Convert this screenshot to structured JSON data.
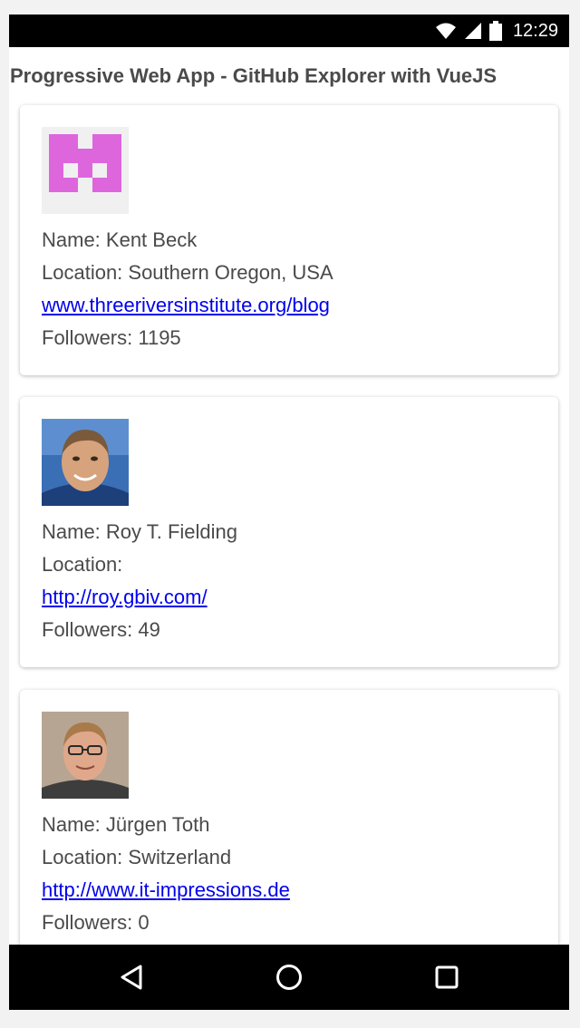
{
  "status_bar": {
    "time": "12:29",
    "icons": [
      "wifi-icon",
      "cell-signal-icon",
      "battery-icon"
    ]
  },
  "page": {
    "title": "Progressive Web App - GitHub Explorer with VueJS"
  },
  "users": [
    {
      "name_line": "Name: Kent Beck",
      "location_line": "Location: Southern Oregon, USA",
      "blog": "www.threeriversinstitute.org/blog",
      "followers_line": "Followers: 1195",
      "avatar": "identicon-avatar"
    },
    {
      "name_line": "Name: Roy T. Fielding",
      "location_line": "Location:",
      "blog": "http://roy.gbiv.com/",
      "followers_line": "Followers: 49",
      "avatar": "photo-avatar"
    },
    {
      "name_line": "Name: Jürgen Toth",
      "location_line": "Location: Switzerland",
      "blog": "http://www.it-impressions.de",
      "followers_line": "Followers: 0",
      "avatar": "photo-avatar"
    }
  ],
  "colors": {
    "text": "#4a4a4a",
    "link": "#0000ee",
    "identicon": "#dd66dd",
    "system_bars": "#000000"
  },
  "nav_bar": {
    "buttons": [
      "back-icon",
      "home-icon",
      "recents-icon"
    ]
  }
}
